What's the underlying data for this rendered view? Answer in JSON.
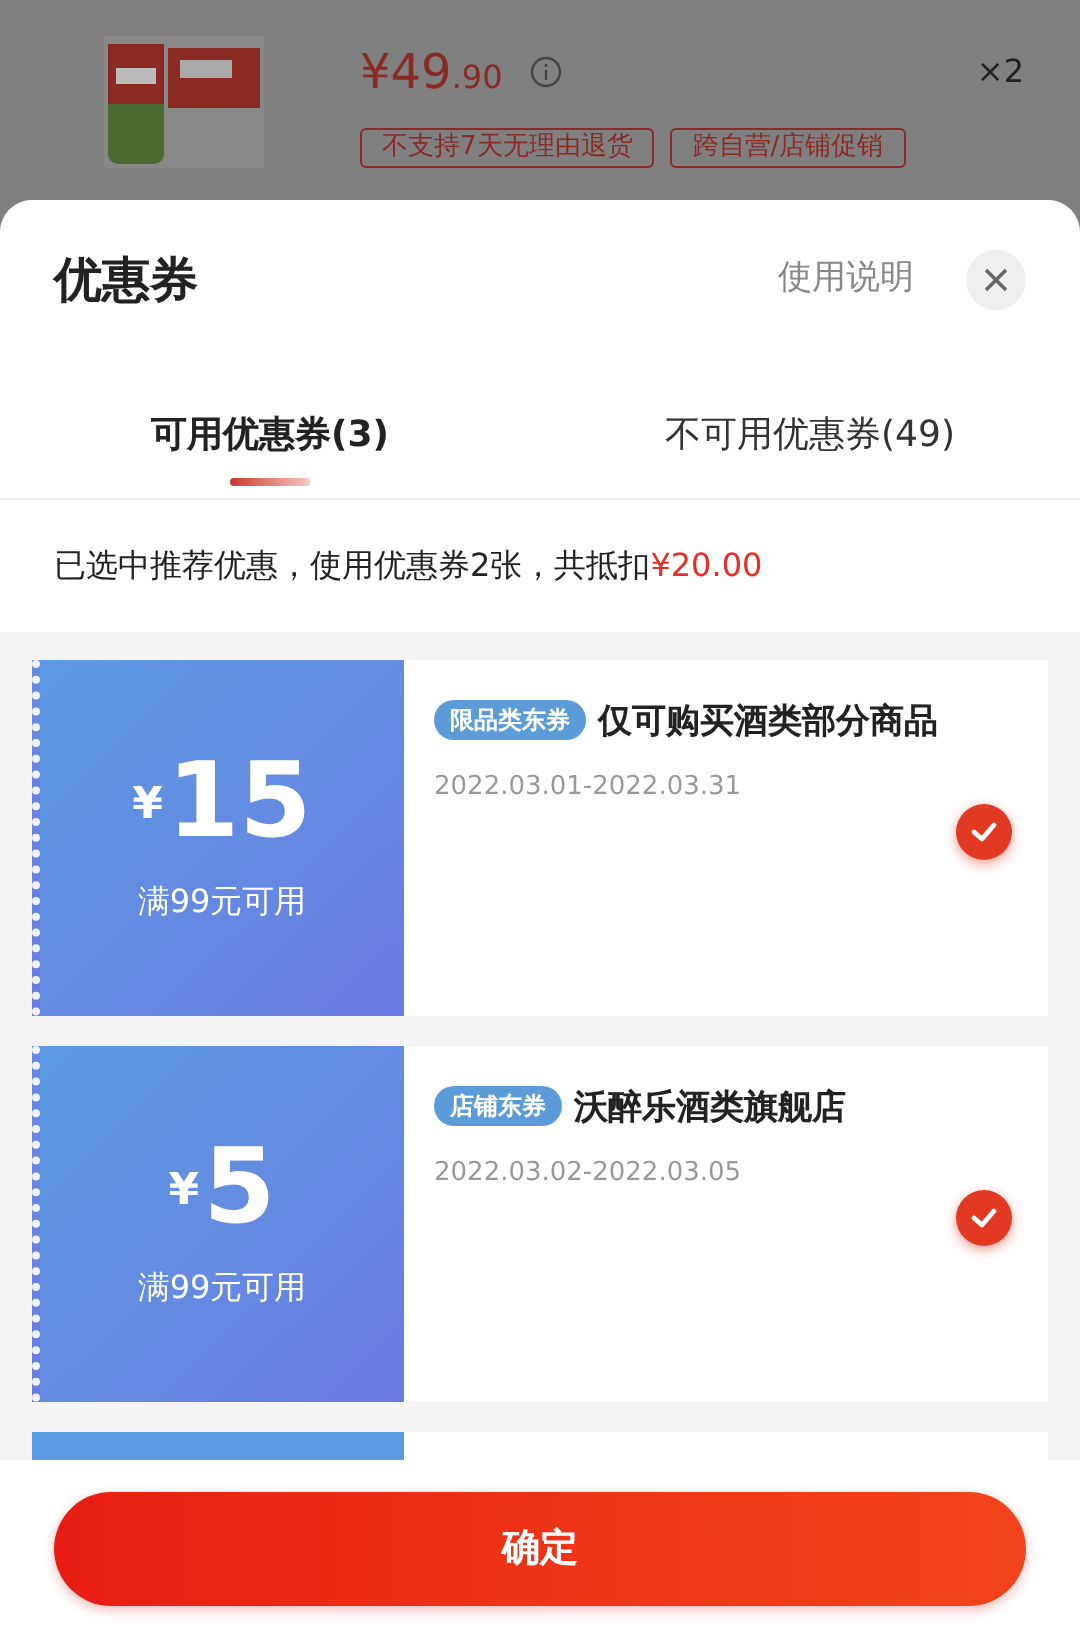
{
  "product": {
    "price_main": "¥49",
    "price_fraction": ".90",
    "quantity": "×2",
    "tags": [
      "不支持7天无理由退货",
      "跨自营/店铺促销"
    ]
  },
  "sheet": {
    "title": "优惠券",
    "help_link": "使用说明"
  },
  "tabs": [
    {
      "label": "可用优惠券(3)",
      "selected": true
    },
    {
      "label": "不可用优惠券(49)",
      "selected": false
    }
  ],
  "summary": {
    "text": "已选中推荐优惠，使用优惠券2张，共抵扣",
    "amount": "¥20.00"
  },
  "coupons": [
    {
      "currency": "¥",
      "amount": "15",
      "condition": "满99元可用",
      "tag": "限品类东券",
      "title": "仅可购买酒类部分商品",
      "dates": "2022.03.01-2022.03.31",
      "selected": true
    },
    {
      "currency": "¥",
      "amount": "5",
      "condition": "满99元可用",
      "tag": "店铺东券",
      "title": "沃醉乐酒类旗舰店",
      "dates": "2022.03.02-2022.03.05",
      "selected": true
    }
  ],
  "confirm_button": "确定"
}
